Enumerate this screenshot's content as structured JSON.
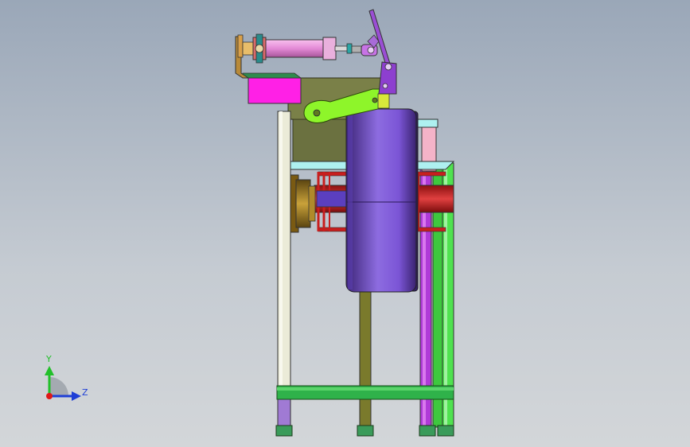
{
  "viewport": {
    "background_top": "#9aa7b8",
    "background_bottom": "#d3d6d9"
  },
  "triad": {
    "y_label": "Y",
    "z_label": "Z",
    "y_color": "#22c02a",
    "z_color": "#1f3fd6",
    "x_color": "#e01818"
  },
  "model": {
    "parts": [
      "cylinder-mount-bracket-icon",
      "pneumatic-cylinder-icon",
      "rod-clevis-icon",
      "pivot-lever-icon",
      "magenta-block-icon",
      "olive-frame-plate-icon",
      "green-lever-arm-icon",
      "purple-drum-icon",
      "bronze-hub-icon",
      "red-shaft-icon",
      "frame-legs-icon",
      "base-crossbar-icon",
      "feet-icon"
    ],
    "colors": {
      "drum": "#7b55d6",
      "cylinder": "#e38ad6",
      "magenta": "#ff20e6",
      "olive": "#7a8048",
      "green": "#3ec83e",
      "lime": "#8ef52a",
      "shaft": "#c81e1e",
      "bronze": "#a07d22"
    }
  }
}
